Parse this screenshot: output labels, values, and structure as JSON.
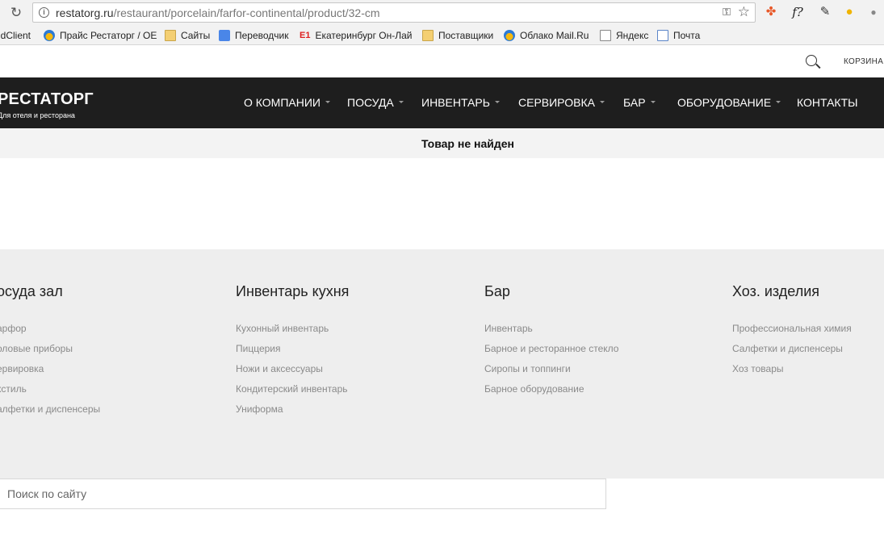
{
  "browser": {
    "url_host": "restatorg.ru",
    "url_path": "/restaurant/porcelain/farfor-continental/product/32-cm",
    "bookmarks": [
      {
        "label": "ldClient",
        "icon": "none"
      },
      {
        "label": "Прайс Рестаторг / OE",
        "icon": "cloud"
      },
      {
        "label": "Сайты",
        "icon": "folder"
      },
      {
        "label": "Переводчик",
        "icon": "translate"
      },
      {
        "label": "Екатеринбург Он-Лай",
        "icon": "e1",
        "icon_text": "E1"
      },
      {
        "label": "Поставщики",
        "icon": "folder"
      },
      {
        "label": "Облако Mail.Ru",
        "icon": "cloud"
      },
      {
        "label": "Яндекс",
        "icon": "doc"
      },
      {
        "label": "Почта",
        "icon": "mail"
      }
    ]
  },
  "header": {
    "cart_label": "КОРЗИНА",
    "logo_title": "РЕСТАТОРГ",
    "logo_subtitle": "Для отеля и ресторана",
    "nav": [
      {
        "label": "О КОМПАНИИ",
        "has_caret": true
      },
      {
        "label": "ПОСУДА",
        "has_caret": true
      },
      {
        "label": "ИНВЕНТАРЬ",
        "has_caret": true
      },
      {
        "label": "СЕРВИРОВКА",
        "has_caret": true
      },
      {
        "label": "БАР",
        "has_caret": true
      },
      {
        "label": "ОБОРУДОВАНИЕ",
        "has_caret": true
      },
      {
        "label": "КОНТАКТЫ",
        "has_caret": false
      }
    ]
  },
  "notice": {
    "text": "Товар не найден"
  },
  "footer": {
    "columns": [
      {
        "title": "осуда зал",
        "links": [
          "арфор",
          "оловые приборы",
          "ервировка",
          "кстиль",
          "алфетки и диспенсеры"
        ]
      },
      {
        "title": "Инвентарь кухня",
        "links": [
          "Кухонный инвентарь",
          "Пиццерия",
          "Ножи и аксессуары",
          "Кондитерский инвентарь",
          "Униформа"
        ]
      },
      {
        "title": "Бар",
        "links": [
          "Инвентарь",
          "Барное и ресторанное стекло",
          "Сиропы и топпинги",
          "Барное оборудование"
        ]
      },
      {
        "title": "Хоз. изделия",
        "links": [
          "Профессиональная химия",
          "Салфетки и диспенсеры",
          "Хоз товары"
        ]
      }
    ],
    "search_placeholder": "Поиск по сайту"
  },
  "colors": {
    "navbar_bg": "#1e1e1e",
    "footer_bg": "#eeeeee",
    "notice_bg": "#f3f3f3",
    "link_gray": "#8a8a8a"
  }
}
